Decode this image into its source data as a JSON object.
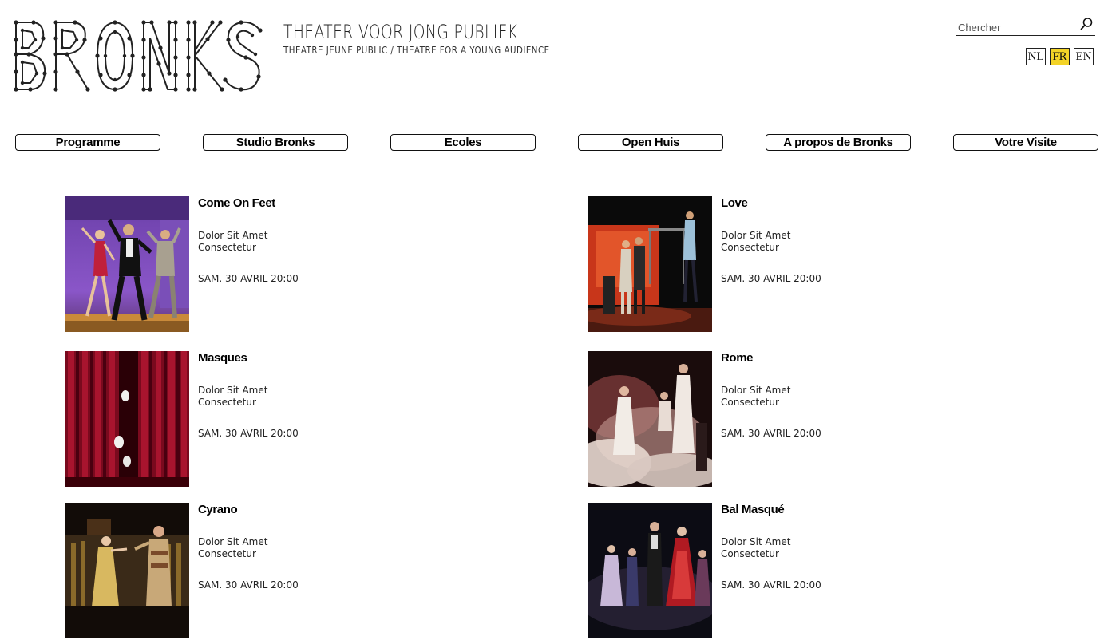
{
  "header": {
    "logo_text": "BRONKS",
    "tagline_main": "THEATER VOOR JONG PUBLIEK",
    "tagline_sub": "THEATRE JEUNE PUBLIC / THEATRE FOR A YOUNG AUDIENCE"
  },
  "search": {
    "placeholder": "Chercher",
    "icon": "search-icon"
  },
  "languages": [
    {
      "code": "NL",
      "active": false
    },
    {
      "code": "FR",
      "active": true
    },
    {
      "code": "EN",
      "active": false
    }
  ],
  "colors": {
    "accent_active_lang": "#f3d327",
    "text": "#111111",
    "background": "#ffffff"
  },
  "nav": {
    "items": [
      {
        "label": "Programme"
      },
      {
        "label": "Studio Bronks"
      },
      {
        "label": "Ecoles"
      },
      {
        "label": "Open Huis"
      },
      {
        "label": "A propos de Bronks"
      },
      {
        "label": "Votre Visite"
      }
    ]
  },
  "shows": [
    {
      "title": "Come On Feet",
      "desc_line1": "Dolor Sit Amet",
      "desc_line2": "Consectetur",
      "date": "SAM. 30 AVRIL 20:00"
    },
    {
      "title": "Love",
      "desc_line1": "Dolor Sit Amet",
      "desc_line2": "Consectetur",
      "date": "SAM. 30 AVRIL 20:00"
    },
    {
      "title": "Masques",
      "desc_line1": "Dolor Sit Amet",
      "desc_line2": "Consectetur",
      "date": "SAM. 30 AVRIL 20:00"
    },
    {
      "title": "Rome",
      "desc_line1": "Dolor Sit Amet",
      "desc_line2": "Consectetur",
      "date": "SAM. 30 AVRIL 20:00"
    },
    {
      "title": "Cyrano",
      "desc_line1": "Dolor Sit Amet",
      "desc_line2": "Consectetur",
      "date": "SAM. 30 AVRIL 20:00"
    },
    {
      "title": "Bal Masqué",
      "desc_line1": "Dolor Sit Amet",
      "desc_line2": "Consectetur",
      "date": "SAM. 30 AVRIL 20:00"
    }
  ]
}
